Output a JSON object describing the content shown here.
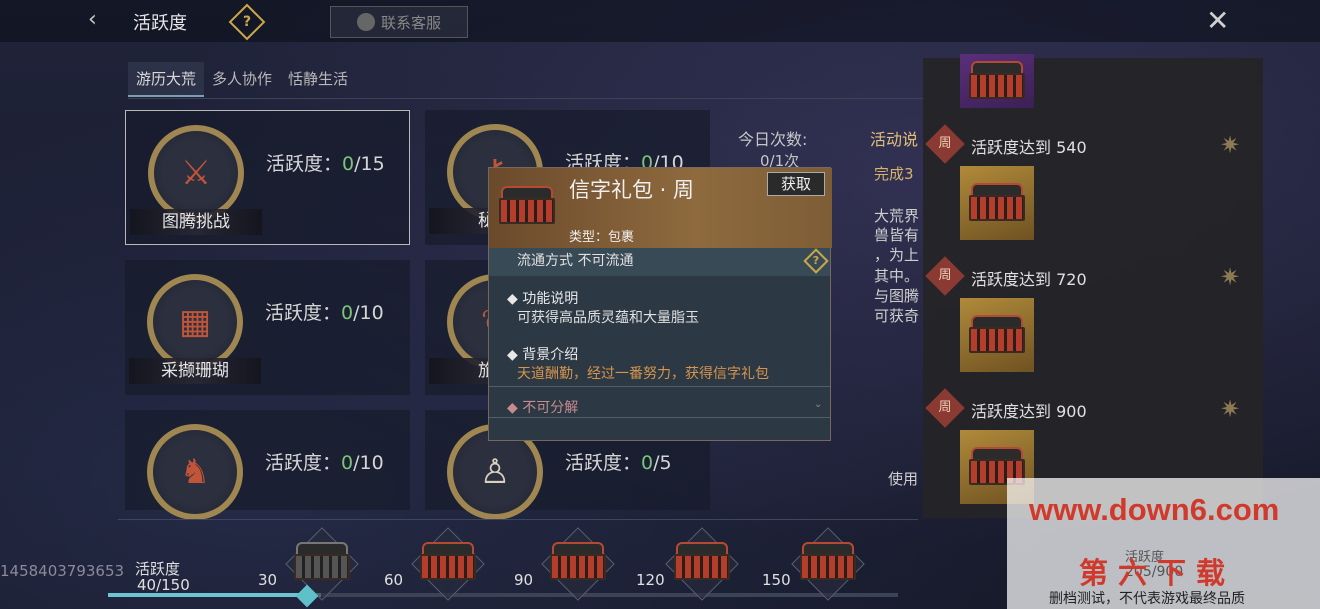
{
  "header": {
    "title": "活跃度",
    "help": "?",
    "service_label": "联系客服"
  },
  "tabs": [
    "游历大荒",
    "多人协作",
    "恬静生活"
  ],
  "cards": [
    {
      "name": "图腾挑战",
      "label": "活跃度：",
      "value": "0",
      "max": "/15"
    },
    {
      "name": "秘境",
      "label": "活跃度：",
      "value": "0",
      "max": "/10"
    },
    {
      "name": "采撷珊瑚",
      "label": "活跃度：",
      "value": "0",
      "max": "/10"
    },
    {
      "name": "旅行",
      "label": "",
      "value": "",
      "max": ""
    },
    {
      "name": "",
      "label": "活跃度：",
      "value": "0",
      "max": "/10"
    },
    {
      "name": "",
      "label": "活跃度：",
      "value": "0",
      "max": "/5"
    }
  ],
  "side": {
    "today_label": "今日次数:",
    "today_value": "0/1次",
    "desc_title": "活动说",
    "desc_lines": [
      "完成3",
      "大荒界",
      "兽皆有",
      "，为上",
      "其中。",
      "与图腾",
      "可获奇"
    ],
    "use_text": "使用"
  },
  "popup": {
    "title": "信字礼包 · 周",
    "get_label": "获取",
    "type": "类型：包裹",
    "circulation": "流通方式   不可流通",
    "help": "?",
    "func_title": "功能说明",
    "func_body": "可获得高品质灵蕴和大量脂玉",
    "bg_title": "背景介绍",
    "bg_body": "天道酬勤，经过一番努力，获得信字礼包",
    "no_decompose": "不可分解"
  },
  "rewards": [
    {
      "badge": "周",
      "text": "活跃度达到 540"
    },
    {
      "badge": "周",
      "text": "活跃度达到 720"
    },
    {
      "badge": "周",
      "text": "活跃度达到 900"
    }
  ],
  "bottom": {
    "uid": "1458403793653",
    "label": "活跃度",
    "value": "40/150",
    "progress": 0.27,
    "milestones": [
      "30",
      "60",
      "90",
      "120",
      "150"
    ],
    "weekly_label": "活跃度",
    "weekly_value": "205/900"
  },
  "watermark": {
    "url": "www.down6.com",
    "title": "第六下载",
    "note": "删档测试，不代表游戏最终品质"
  },
  "colors": {
    "accent_green": "#7cc47a",
    "gold": "#caa84a",
    "progress": "#6fc4d2",
    "watermark_red": "#d03a2c"
  }
}
